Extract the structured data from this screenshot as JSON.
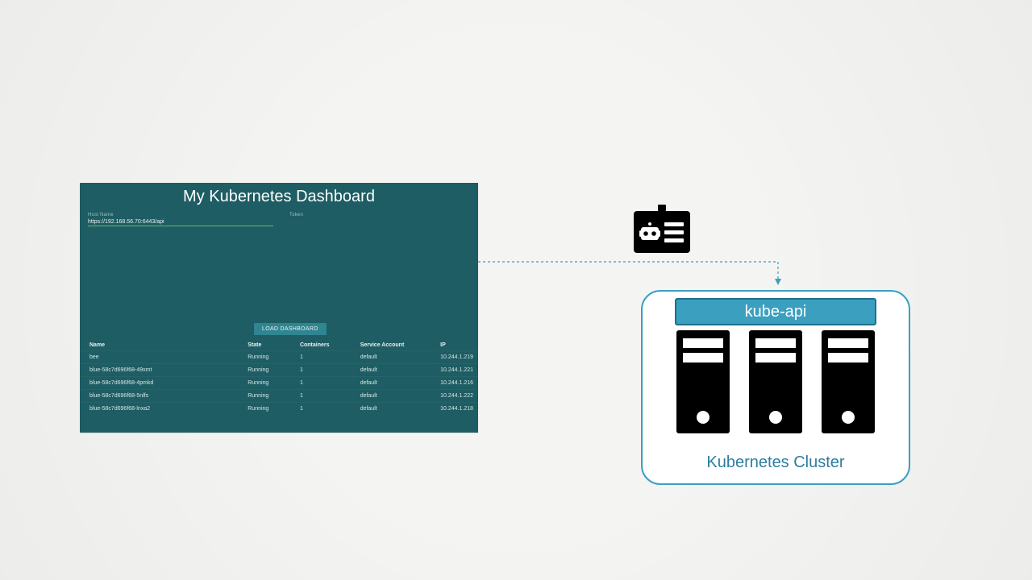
{
  "dashboard": {
    "title": "My Kubernetes Dashboard",
    "host_label": "Host Name",
    "host_value": "https://192.168.56.70:6443/api",
    "token_label": "Token",
    "load_button": "LOAD DASHBOARD",
    "columns": [
      "Name",
      "State",
      "Containers",
      "Service Account",
      "IP"
    ],
    "rows": [
      {
        "name": "bee",
        "state": "Running",
        "containers": "1",
        "sa": "default",
        "ip": "10.244.1.219"
      },
      {
        "name": "blue-58c7d696f68-49xmt",
        "state": "Running",
        "containers": "1",
        "sa": "default",
        "ip": "10.244.1.221"
      },
      {
        "name": "blue-58c7d696f68-4pmkd",
        "state": "Running",
        "containers": "1",
        "sa": "default",
        "ip": "10.244.1.216"
      },
      {
        "name": "blue-58c7d696f68-5nlfs",
        "state": "Running",
        "containers": "1",
        "sa": "default",
        "ip": "10.244.1.222"
      },
      {
        "name": "blue-58c7d696f68-lnxa2",
        "state": "Running",
        "containers": "1",
        "sa": "default",
        "ip": "10.244.1.218"
      }
    ]
  },
  "cluster": {
    "api_label": "kube-api",
    "label": "Kubernetes Cluster",
    "server_count": 3
  },
  "icons": {
    "badge": "id-badge-icon",
    "server": "server-icon"
  }
}
